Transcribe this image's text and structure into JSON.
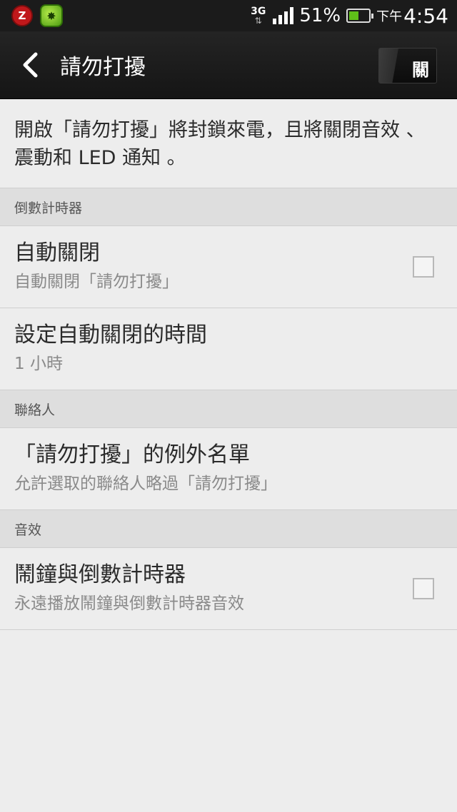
{
  "status_bar": {
    "icons": [
      "z-app-icon",
      "shield-app-icon",
      "network-3g-icon",
      "signal-icon",
      "battery-icon"
    ],
    "network_type": "3G",
    "battery_percent": "51%",
    "battery_level": 0.51,
    "time_prefix": "下午",
    "time": "4:54"
  },
  "action_bar": {
    "title": "請勿打擾",
    "toggle_label": "關"
  },
  "description": "開啟「請勿打擾」將封鎖來電，且將關閉音效 、震動和 LED 通知 。",
  "sections": [
    {
      "header": "倒數計時器",
      "items": [
        {
          "title": "自動關閉",
          "subtitle": "自動關閉「請勿打擾」",
          "checkbox": false
        },
        {
          "title": "設定自動關閉的時間",
          "subtitle": "1 小時"
        }
      ]
    },
    {
      "header": "聯絡人",
      "items": [
        {
          "title": "「請勿打擾」的例外名單",
          "subtitle": "允許選取的聯絡人略過「請勿打擾」"
        }
      ]
    },
    {
      "header": "音效",
      "items": [
        {
          "title": "鬧鐘與倒數計時器",
          "subtitle": "永遠播放鬧鐘與倒數計時器音效",
          "checkbox": false
        }
      ]
    }
  ],
  "colors": {
    "background": "#ededed",
    "action_bar": "#1b1b1b",
    "section_header": "#dedede",
    "battery_green": "#5fbf19"
  }
}
